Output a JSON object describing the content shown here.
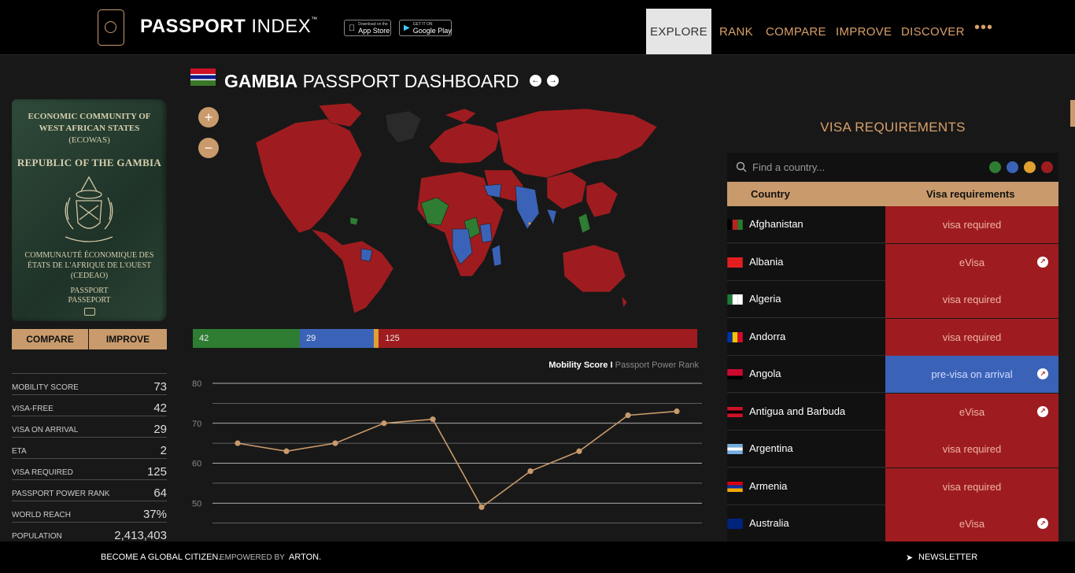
{
  "header": {
    "logo_bold": "PASSPORT",
    "logo_light": "INDEX",
    "logo_tm": "™",
    "app_store_small": "Download on the",
    "app_store_big": "App Store",
    "google_play_small": "GET IT ON",
    "google_play_big": "Google Play",
    "nav": [
      "EXPLORE",
      "RANK",
      "COMPARE",
      "IMPROVE",
      "DISCOVER"
    ],
    "nav_more": "•••"
  },
  "passport": {
    "cover_line1": "ECONOMIC COMMUNITY OF",
    "cover_line2": "WEST AFRICAN STATES",
    "cover_line3": "(ECOWAS)",
    "cover_line4": "REPUBLIC OF THE GAMBIA",
    "cover_line5": "COMMUNAUTÉ ÉCONOMIQUE DES",
    "cover_line6": "ÉTATS DE L'AFRIQUE DE L'OUEST",
    "cover_line7": "(CEDEAO)",
    "cover_line8": "PASSPORT",
    "cover_line9": "PASSEPORT",
    "compare_label": "COMPARE",
    "improve_label": "IMPROVE"
  },
  "stats": [
    {
      "label": "MOBILITY SCORE",
      "value": "73"
    },
    {
      "label": "VISA-FREE",
      "value": "42"
    },
    {
      "label": "VISA ON ARRIVAL",
      "value": "29"
    },
    {
      "label": "ETA",
      "value": "2"
    },
    {
      "label": "VISA REQUIRED",
      "value": "125"
    },
    {
      "label": "PASSPORT POWER RANK",
      "value": "64"
    },
    {
      "label": "WORLD REACH",
      "value": "37%"
    },
    {
      "label": "POPULATION",
      "value": "2,413,403"
    }
  ],
  "dashboard": {
    "title_bold": "GAMBIA",
    "title_rest": "PASSPORT DASHBOARD",
    "zoom_in": "+",
    "zoom_out": "−"
  },
  "breakdown": {
    "visa_free": 42,
    "visa_on_arrival": 29,
    "eta": 2,
    "visa_required": 125,
    "colors": {
      "visa_free": "#2e7d32",
      "visa_on_arrival": "#3a63b8",
      "eta": "#e0a030",
      "visa_required": "#9e1c1f"
    }
  },
  "chart_legend": {
    "active": "Mobility Score",
    "separator": "I",
    "inactive": "Passport Power Rank"
  },
  "chart_data": {
    "type": "line",
    "ylim": [
      40,
      80
    ],
    "yticks": [
      50,
      60,
      70,
      80
    ],
    "values": [
      65,
      63,
      65,
      70,
      71,
      49,
      58,
      63,
      72,
      73
    ],
    "color": "#c99a6b",
    "grid": true
  },
  "visa_panel": {
    "title": "VISA REQUIREMENTS",
    "search_placeholder": "Find a country...",
    "col_country": "Country",
    "col_requirement": "Visa requirements",
    "rows": [
      {
        "country": "Afghanistan",
        "requirement": "visa required",
        "link": false,
        "type": "red"
      },
      {
        "country": "Albania",
        "requirement": "eVisa",
        "link": true,
        "type": "red"
      },
      {
        "country": "Algeria",
        "requirement": "visa required",
        "link": false,
        "type": "red"
      },
      {
        "country": "Andorra",
        "requirement": "visa required",
        "link": false,
        "type": "red"
      },
      {
        "country": "Angola",
        "requirement": "pre-visa on arrival",
        "link": true,
        "type": "blue"
      },
      {
        "country": "Antigua and Barbuda",
        "requirement": "eVisa",
        "link": true,
        "type": "red"
      },
      {
        "country": "Argentina",
        "requirement": "visa required",
        "link": false,
        "type": "red"
      },
      {
        "country": "Armenia",
        "requirement": "visa required",
        "link": false,
        "type": "red"
      },
      {
        "country": "Australia",
        "requirement": "eVisa",
        "link": true,
        "type": "red"
      }
    ]
  },
  "footer": {
    "left_1": "BECOME A GLOBAL CITIZEN.",
    "left_2": "EMPOWERED BY",
    "left_3": "ARTON.",
    "newsletter": "NEWSLETTER"
  }
}
